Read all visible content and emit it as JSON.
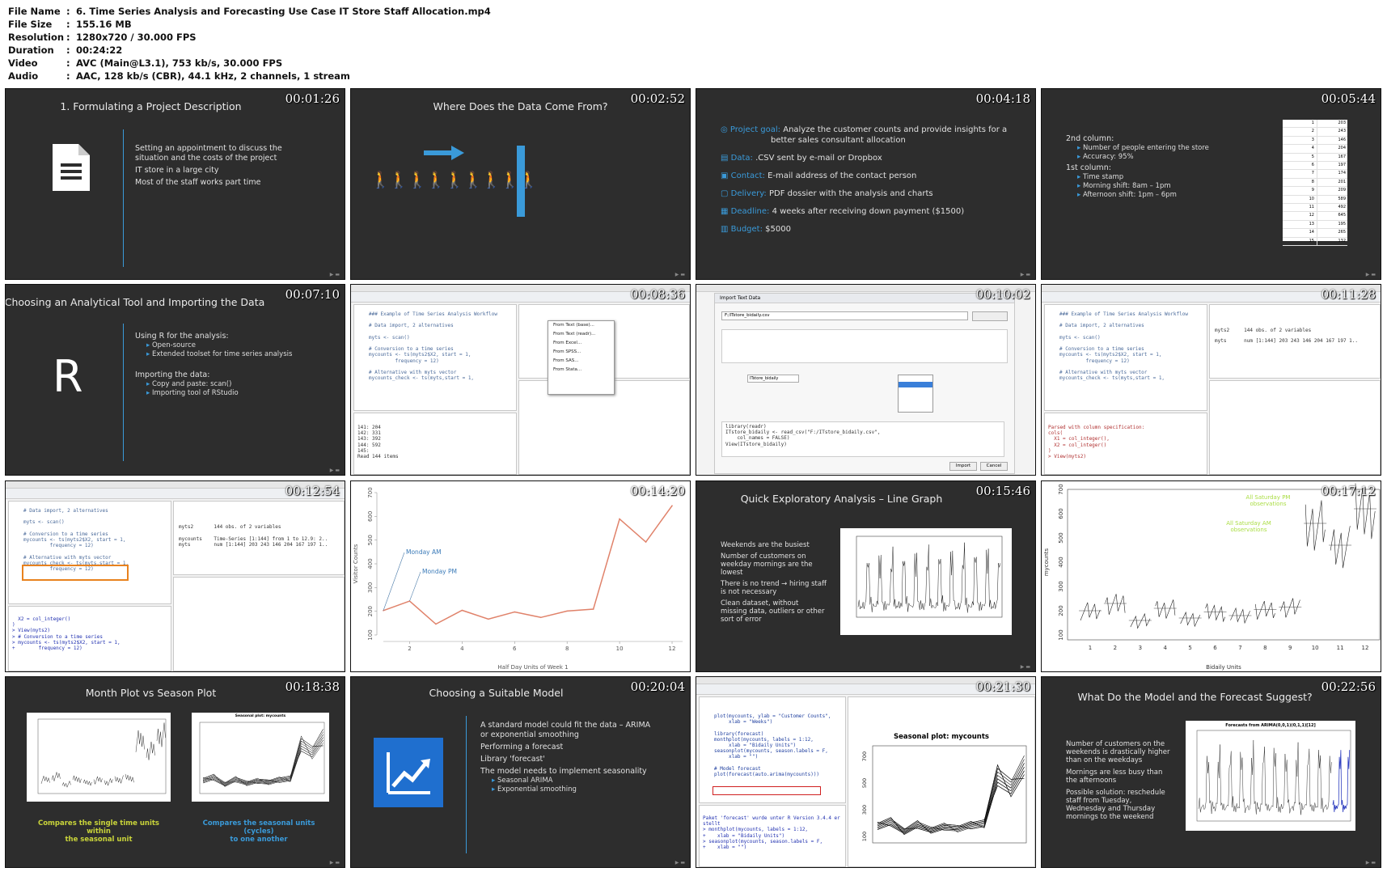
{
  "meta": {
    "rows": [
      {
        "k": "File Name",
        "v": "6. Time Series Analysis and Forecasting Use Case IT Store Staff Allocation.mp4"
      },
      {
        "k": "File Size",
        "v": "155.16 MB"
      },
      {
        "k": "Resolution",
        "v": "1280x720 / 30.000 FPS"
      },
      {
        "k": "Duration",
        "v": "00:24:22"
      },
      {
        "k": "Video",
        "v": "AVC (Main@L3.1), 753 kb/s, 30.000 FPS"
      },
      {
        "k": "Audio",
        "v": "AAC, 128 kb/s (CBR), 44.1 kHz, 2 channels, 1 stream"
      }
    ]
  },
  "thumbs": {
    "t1": {
      "ts": "00:01:26",
      "title": "1. Formulating a Project Description",
      "lines": [
        "Setting an appointment to discuss the",
        "situation and the costs of the project",
        "IT store in a large city",
        "Most of the staff works part time"
      ]
    },
    "t2": {
      "ts": "00:02:52",
      "title": "Where Does the Data Come From?"
    },
    "t3": {
      "ts": "00:04:18",
      "items": [
        {
          "label": "Project goal:",
          "text": "Analyze the customer counts and provide insights for a",
          "text2": "better sales consultant allocation"
        },
        {
          "label": "Data:",
          "text": ".CSV sent by e-mail or Dropbox"
        },
        {
          "label": "Contact:",
          "text": "E-mail address of the contact person"
        },
        {
          "label": "Delivery:",
          "text": "PDF dossier with the analysis and charts"
        },
        {
          "label": "Deadline:",
          "text": "4 weeks after receiving down payment ($1500)"
        },
        {
          "label": "Budget:",
          "text": "$5000"
        }
      ]
    },
    "t4": {
      "ts": "00:05:44",
      "col2": "2nd column:",
      "col2a": "Number of people entering the store",
      "col2b": "Accuracy: 95%",
      "col1": "1st column:",
      "col1a": "Time stamp",
      "col1b": "Morning shift: 8am – 1pm",
      "col1c": "Afternoon shift: 1pm – 6pm",
      "sheet": [
        [
          "1",
          "203"
        ],
        [
          "2",
          "243"
        ],
        [
          "3",
          "146"
        ],
        [
          "4",
          "204"
        ],
        [
          "5",
          "167"
        ],
        [
          "6",
          "197"
        ],
        [
          "7",
          "174"
        ],
        [
          "8",
          "201"
        ],
        [
          "9",
          "209"
        ],
        [
          "10",
          "589"
        ],
        [
          "11",
          "492"
        ],
        [
          "12",
          "645"
        ],
        [
          "13",
          "195"
        ],
        [
          "14",
          "265"
        ],
        [
          "15",
          "132"
        ]
      ]
    },
    "t5": {
      "ts": "00:07:10",
      "title": "Choosing an Analytical Tool and Importing the Data",
      "letter": "R",
      "h1": "Using R for the analysis:",
      "s1": "Open-source",
      "s2": "Extended toolset for time series analysis",
      "h2": "Importing the data:",
      "s3": "Copy and paste: scan()",
      "s4": "Importing tool of RStudio"
    },
    "t6": {
      "ts": "00:08:36",
      "code": "### Example of Time Series Analysis Workflow\n\n# Data import, 2 alternatives\n\nmyts <- scan()\n\n# Conversion to a time series\nmycounts <- ts(myts2$X2, start = 1,\n         frequency = 12)\n\n# Alternative with myts vector\nmycounts_check <- ts(myts,start = 1,",
      "console": "141: 204\n142: 331\n143: 392\n144: 592\n145:\nRead 144 items",
      "menu": [
        "From Text (base)...",
        "From Text (readr)...",
        "From Excel...",
        "From SPSS...",
        "From SAS...",
        "From Stata..."
      ]
    },
    "t7": {
      "ts": "00:10:02",
      "dialog": "Import Text Data",
      "file": "F:/ITstore_bidaily.csv",
      "name": "ITstore_bidaily",
      "code": "library(readr)\nITstore_bidaily <- read_csv(\"F:/ITstore_bidaily.csv\",\n    col_names = FALSE)\nView(ITstore_bidaily)",
      "import": "Import",
      "cancel": "Cancel"
    },
    "t8": {
      "ts": "00:11:28",
      "code": "### Example of Time Series Analysis Workflow\n\n# Data import, 2 alternatives\n\nmyts <- scan()\n\n# Conversion to a time series\nmycounts <- ts(myts2$X2, start = 1,\n         frequency = 12)\n\n# Alternative with myts vector\nmycounts_check <- ts(myts,start = 1,",
      "env1": "myts2     144 obs. of 2 variables",
      "env2": "myts      num [1:144] 203 243 146 204 167 197 1..",
      "console": "Parsed with column specification:\ncols(\n  X1 = col_integer(),\n  X2 = col_integer()\n)\n> View(myts2)"
    },
    "t9": {
      "ts": "00:12:54",
      "code": "# Data import, 2 alternatives\n\nmyts <- scan()\n\n# Conversion to a time series\nmycounts <- ts(myts2$X2, start = 1,\n         frequency = 12)\n\n# Alternative with myts vector\nmycounts_check <- ts(myts,start = 1,\n         frequency = 12)",
      "env1": "myts2       144 obs. of 2 variables",
      "env2": "mycounts    Time-Series [1:144] from 1 to 12.9: 2..",
      "env3": "myts        num [1:144] 203 243 146 204 167 197 1..",
      "console": "  X2 = col_integer()\n)\n> View(myts2)\n> # Conversion to a time series\n> mycounts <- ts(myts2$X2, start = 1,\n+        frequency = 12)"
    },
    "t10": {
      "ts": "00:14:20",
      "ylabel": "Visitor Counts",
      "xlabel": "Half Day Units of Week 1",
      "ann1": "Monday AM",
      "ann2": "Monday PM",
      "yticks": [
        "100",
        "200",
        "300",
        "400",
        "500",
        "600",
        "700"
      ],
      "xticks": [
        "2",
        "4",
        "6",
        "8",
        "10",
        "12"
      ]
    },
    "t11": {
      "ts": "00:15:46",
      "title": "Quick Exploratory Analysis – Line Graph",
      "l1": "Weekends are the busiest",
      "l2": "Number of customers on",
      "l2b": "weekday mornings are the",
      "l2c": "lowest",
      "l3": "There is no trend → hiring staff",
      "l3b": "is not necessary",
      "l4": "Clean dataset, without",
      "l4b": "missing data, outliers or other",
      "l4c": "sort of error"
    },
    "t12": {
      "ts": "00:17:12",
      "ylabel": "mycounts",
      "xlabel": "Bidaily Units",
      "ann1": "All Saturday PM",
      "ann1b": "observations",
      "ann2": "All Saturday AM",
      "ann2b": "observations",
      "yticks": [
        "100",
        "200",
        "300",
        "400",
        "500",
        "600",
        "700"
      ],
      "xticks": [
        "1",
        "2",
        "3",
        "4",
        "5",
        "6",
        "7",
        "8",
        "9",
        "10",
        "11",
        "12"
      ]
    },
    "t13": {
      "ts": "00:18:38",
      "title": "Month Plot vs Season Plot",
      "splot": "Seasonal plot: mycounts",
      "cap1": "Compares the single time units within",
      "cap1b": "the seasonal unit",
      "cap2": "Compares the seasonal units (cycles)",
      "cap2b": "to one another"
    },
    "t14": {
      "ts": "00:20:04",
      "title": "Choosing a Suitable Model",
      "l1": "A standard model could fit the data – ARIMA",
      "l1b": "or exponential smoothing",
      "l2": "Performing a forecast",
      "l3": "Library 'forecast'",
      "l4": "The model needs to implement seasonality",
      "s1": "Seasonal ARIMA",
      "s2": "Exponential smoothing"
    },
    "t15": {
      "ts": "00:21:30",
      "splot": "Seasonal plot: mycounts",
      "code": "plot(mycounts, ylab = \"Customer Counts\",\n     xlab = \"Weeks\")\n\nlibrary(forecast)\nmonthplot(mycounts, labels = 1:12,\n     xlab = \"Bidaily Units\")\nseasonplot(mycounts, season.labels = F,\n     xlab = \"\")\n\n# Model forecast\nplot(forecast(auto.arima(mycounts)))",
      "console": "Paket 'forecast' wurde unter R Version 3.4.4 er\nstellt\n> monthplot(mycounts, labels = 1:12,\n+    xlab = \"Bidaily Units\")\n> seasonplot(mycounts, season.labels = F,\n+    xlab = \"\")",
      "yticks": [
        "100",
        "300",
        "500",
        "700"
      ]
    },
    "t16": {
      "ts": "00:22:56",
      "title": "What Do the Model and the Forecast Suggest?",
      "fplot": "Forecasts from ARIMA(0,0,1)(0,1,1)[12]",
      "l1": "Number of customers on the",
      "l1b": "weekends is drastically higher",
      "l1c": "than on the weekdays",
      "l2": "Mornings are less busy than",
      "l2b": "the afternoons",
      "l3": "Possible solution: reschedule",
      "l3b": "staff from Tuesday,",
      "l3c": "Wednesday and Thursday",
      "l3d": "mornings to the weekend"
    }
  },
  "chart_data": {
    "type": "line",
    "title": "",
    "xlabel": "Half Day Units of Week 1",
    "ylabel": "Visitor Counts",
    "x": [
      1,
      2,
      3,
      4,
      5,
      6,
      7,
      8,
      9,
      10,
      11,
      12
    ],
    "values": [
      203,
      243,
      146,
      204,
      167,
      197,
      174,
      201,
      209,
      589,
      492,
      645
    ],
    "ylim": [
      100,
      700
    ],
    "xlim": [
      1,
      12.4
    ]
  }
}
